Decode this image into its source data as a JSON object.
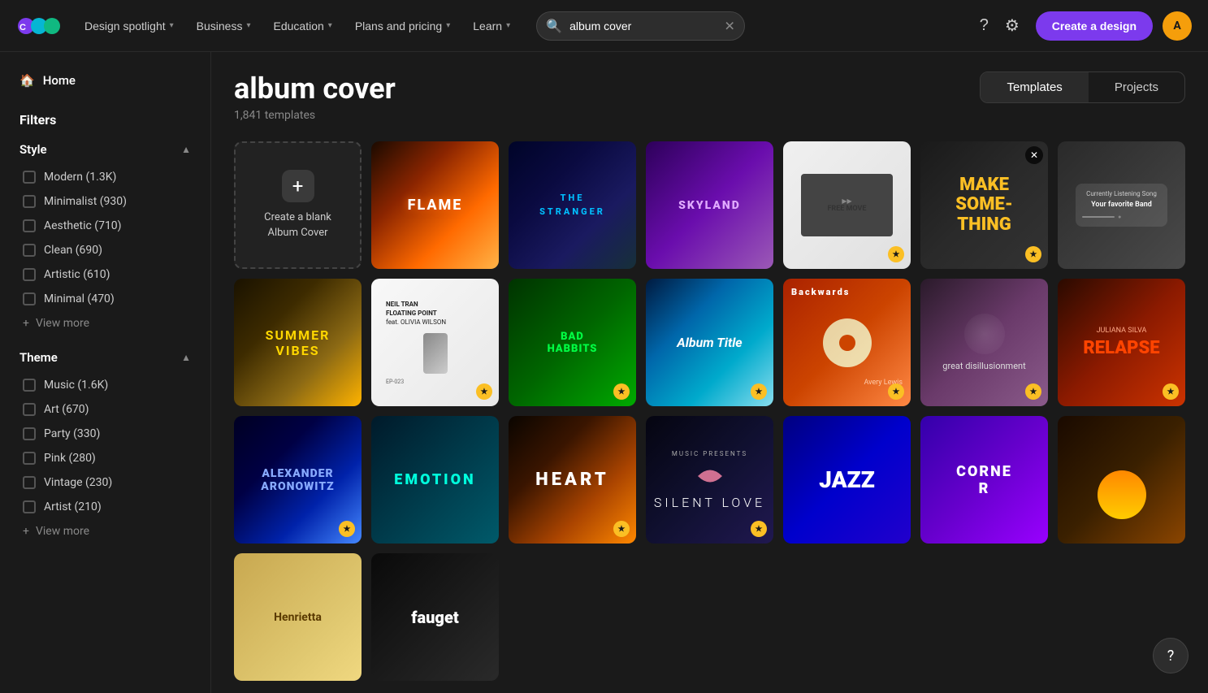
{
  "nav": {
    "logo_text": "Canva",
    "design_spotlight": "Design spotlight",
    "business": "Business",
    "education": "Education",
    "plans_pricing": "Plans and pricing",
    "learn": "Learn",
    "search_placeholder": "album cover",
    "search_value": "album cover",
    "create_btn": "Create a design",
    "avatar_initials": "A"
  },
  "sidebar": {
    "home_label": "Home",
    "filters_title": "Filters",
    "style": {
      "label": "Style",
      "items": [
        {
          "name": "Modern",
          "count": "1.3K"
        },
        {
          "name": "Minimalist",
          "count": "930"
        },
        {
          "name": "Aesthetic",
          "count": "710"
        },
        {
          "name": "Clean",
          "count": "690"
        },
        {
          "name": "Artistic",
          "count": "610"
        },
        {
          "name": "Minimal",
          "count": "470"
        }
      ],
      "view_more": "View more"
    },
    "theme": {
      "label": "Theme",
      "items": [
        {
          "name": "Music",
          "count": "1.6K"
        },
        {
          "name": "Art",
          "count": "670"
        },
        {
          "name": "Party",
          "count": "330"
        },
        {
          "name": "Pink",
          "count": "280"
        },
        {
          "name": "Vintage",
          "count": "230"
        },
        {
          "name": "Artist",
          "count": "210"
        }
      ],
      "view_more": "View more"
    }
  },
  "content": {
    "title": "album cover",
    "count": "1,841 templates",
    "tabs": [
      {
        "id": "templates",
        "label": "Templates",
        "active": true
      },
      {
        "id": "projects",
        "label": "Projects",
        "active": false
      }
    ],
    "create_blank": {
      "label": "Create a blank\nAlbum Cover"
    },
    "cards": [
      {
        "id": "flame",
        "class": "card-flame",
        "text": "FLAME",
        "text_class": "ct-flame",
        "pro": false
      },
      {
        "id": "stranger",
        "class": "card-stranger",
        "text": "THE STRANGER",
        "text_class": "ct-stranger",
        "pro": false
      },
      {
        "id": "skyland",
        "class": "card-skyland",
        "text": "SKYLAND",
        "text_class": "ct-skyland",
        "pro": false
      },
      {
        "id": "freemove",
        "class": "card-freemove",
        "text": "FREE MOVE",
        "text_class": "ct-freemove",
        "pro": true
      },
      {
        "id": "makesomething",
        "class": "card-makesomething",
        "text": "MAKE SOMETHING",
        "text_class": "ct-make",
        "pro": true,
        "close": true
      },
      {
        "id": "listening",
        "class": "card-listening",
        "text": "",
        "text_class": "",
        "pro": false
      },
      {
        "id": "summer",
        "class": "card-summer",
        "text": "SUMMER VIBES",
        "text_class": "ct-summer",
        "pro": false
      },
      {
        "id": "neil",
        "class": "card-neil",
        "text": "NEIL TRAN FLOATING POINT",
        "text_class": "ct-neil",
        "pro": true
      },
      {
        "id": "badhabbits",
        "class": "card-badhabbits",
        "text": "BAD HABBITS",
        "text_class": "ct-bad",
        "pro": true
      },
      {
        "id": "albumtitle",
        "class": "card-albumtitle",
        "text": "Album Title",
        "text_class": "ct-album",
        "pro": true
      },
      {
        "id": "backwards",
        "class": "card-backwards",
        "text": "Backwards",
        "text_class": "ct-back",
        "pro": true
      },
      {
        "id": "disillusionment",
        "class": "card-disillusionment",
        "text": "great disillusionment",
        "text_class": "ct-great",
        "pro": true
      },
      {
        "id": "relapse",
        "class": "card-relapse",
        "text": "RELAPSE",
        "text_class": "ct-relapse",
        "pro": true
      },
      {
        "id": "alexander",
        "class": "card-alexander",
        "text": "ALEXANDER ARONOWITZ",
        "text_class": "ct-alex",
        "pro": true
      },
      {
        "id": "emotion",
        "class": "card-emotion",
        "text": "EMOTION",
        "text_class": "ct-emotion",
        "pro": false
      },
      {
        "id": "heart",
        "class": "card-heart",
        "text": "HEART",
        "text_class": "ct-heart",
        "pro": true
      },
      {
        "id": "silentlove",
        "class": "card-silentlove",
        "text": "SILENT LOVE",
        "text_class": "ct-silent",
        "pro": true
      },
      {
        "id": "jazz",
        "class": "card-jazz",
        "text": "JAZZ",
        "text_class": "ct-jazz",
        "pro": false
      },
      {
        "id": "corner",
        "class": "card-corner",
        "text": "",
        "text_class": "",
        "pro": false
      },
      {
        "id": "sunset",
        "class": "card-sunset",
        "text": "",
        "text_class": "",
        "pro": false
      },
      {
        "id": "henrietta",
        "class": "card-henrietta",
        "text": "Henrietta",
        "text_class": "ct-henrietta",
        "pro": false
      },
      {
        "id": "fauget",
        "class": "card-fauget",
        "text": "fauget",
        "text_class": "ct-fauget",
        "pro": false
      }
    ]
  },
  "help": {
    "label": "?"
  }
}
